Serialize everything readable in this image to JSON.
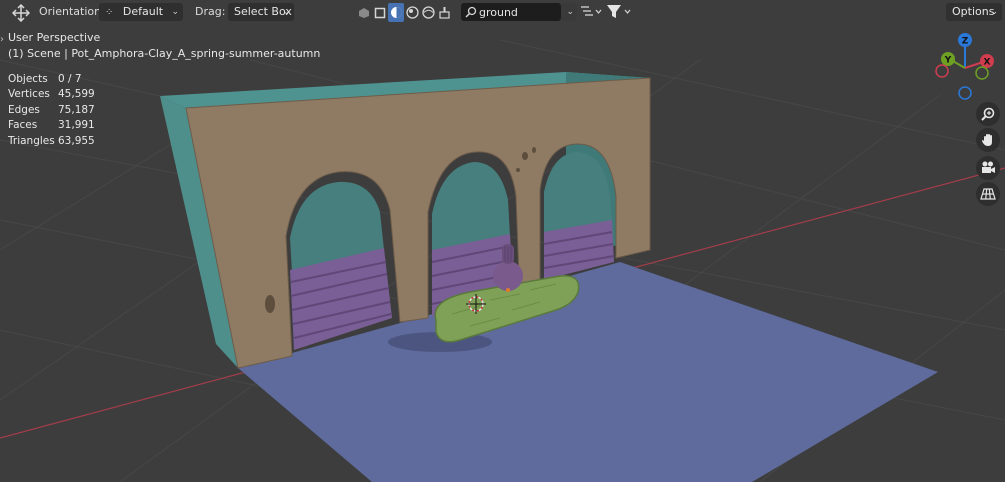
{
  "header": {
    "orientation_label": "Orientation:",
    "orientation_value": "Default",
    "drag_label": "Drag:",
    "drag_value": "Select Box",
    "search_value": "ground",
    "options_label": "Options"
  },
  "overlay": {
    "view_name": "User Perspective",
    "scene_info": "(1) Scene | Pot_Amphora-Clay_A_spring-summer-autumn"
  },
  "stats": [
    {
      "label": "Objects",
      "value": "0 / 7"
    },
    {
      "label": "Vertices",
      "value": "45,599"
    },
    {
      "label": "Edges",
      "value": "75,187"
    },
    {
      "label": "Faces",
      "value": "31,991"
    },
    {
      "label": "Triangles",
      "value": "63,955"
    }
  ],
  "gizmo": {
    "z": "Z",
    "y": "Y",
    "x": "X",
    "colors": {
      "x": "#cf3d4f",
      "y": "#6ea024",
      "z": "#2a78d8",
      "axis_x_line": "#a33d4a"
    }
  },
  "nav_icons": [
    "zoom-icon",
    "hand-pan-icon",
    "camera-icon",
    "grid-perspective-icon"
  ],
  "colors": {
    "background": "#3d3d3d",
    "floor": "#5e6b9c",
    "wall_front": "#8f7b64",
    "wall_side": "#4e8f8c",
    "stairs": "#7a5e96",
    "log": "#7fa157",
    "active_button": "#4772b3"
  }
}
